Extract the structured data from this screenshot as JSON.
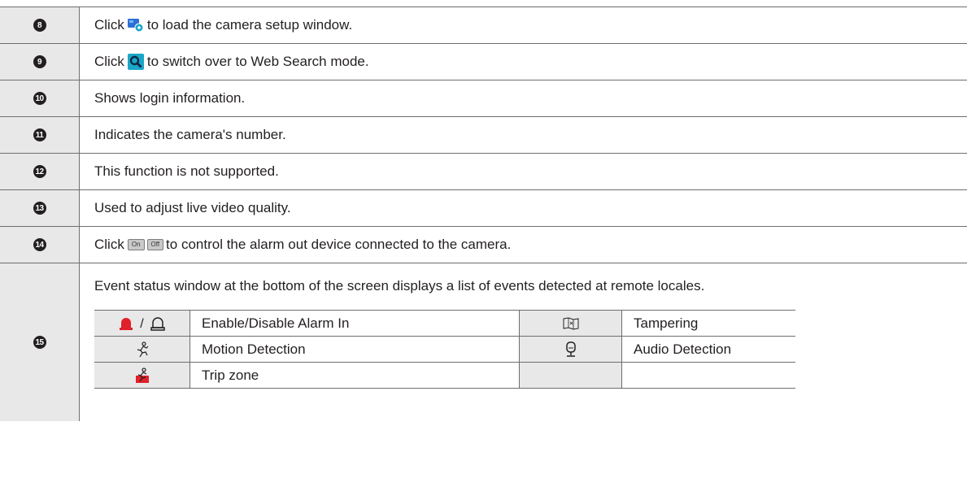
{
  "rows": [
    {
      "num": "8",
      "before": "Click",
      "icon": "camera-setup-icon",
      "after": "to load the camera setup window."
    },
    {
      "num": "9",
      "before": "Click",
      "icon": "web-search-icon",
      "after": "to switch over to Web Search mode."
    },
    {
      "num": "10",
      "text": "Shows login information."
    },
    {
      "num": "11",
      "text": "Indicates the camera's number."
    },
    {
      "num": "12",
      "text": "This function is not supported."
    },
    {
      "num": "13",
      "text": "Used to adjust live video quality."
    },
    {
      "num": "14",
      "before": "Click",
      "on_label": "On",
      "off_label": "Off",
      "after": "to control the alarm out device connected to the camera."
    }
  ],
  "event_row": {
    "num": "15",
    "text": "Event status window at the bottom of the screen displays a list of events detected at remote locales.",
    "slash": "/",
    "items": {
      "alarm_in": {
        "icon": "alarm-in-icon",
        "label": "Enable/Disable Alarm In"
      },
      "tampering": {
        "icon": "tampering-icon",
        "label": "Tampering"
      },
      "motion": {
        "icon": "motion-detection-icon",
        "label": "Motion Detection"
      },
      "audio": {
        "icon": "audio-detection-icon",
        "label": "Audio Detection"
      },
      "trip": {
        "icon": "trip-zone-icon",
        "label": "Trip zone"
      }
    }
  },
  "colors": {
    "alarm_red": "#e0202a",
    "cam_blue": "#2c6fd6",
    "search_teal": "#1ba6c8",
    "trip_red": "#e0202a",
    "number_cell_bg": "#e8e8e9"
  }
}
